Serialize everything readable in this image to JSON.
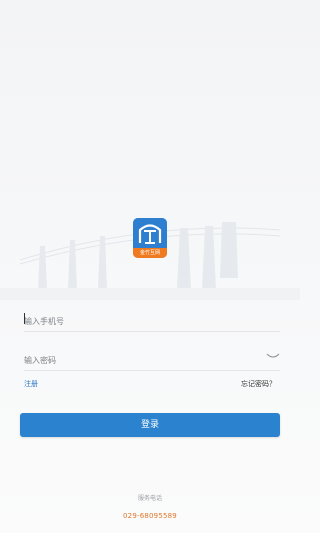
{
  "logo": {
    "caption": "金竹互网"
  },
  "form": {
    "phone_placeholder": "输入手机号",
    "password_placeholder": "输入密码"
  },
  "links": {
    "register": "注册",
    "forgot_password": "忘记密码？"
  },
  "login_button": "登录",
  "footer": {
    "service_label": "服务电话",
    "service_phone": "029-68095589"
  },
  "colors": {
    "accent": "#2b82cf",
    "phone": "#e2772a",
    "logo_strip": "#f07a1f"
  }
}
